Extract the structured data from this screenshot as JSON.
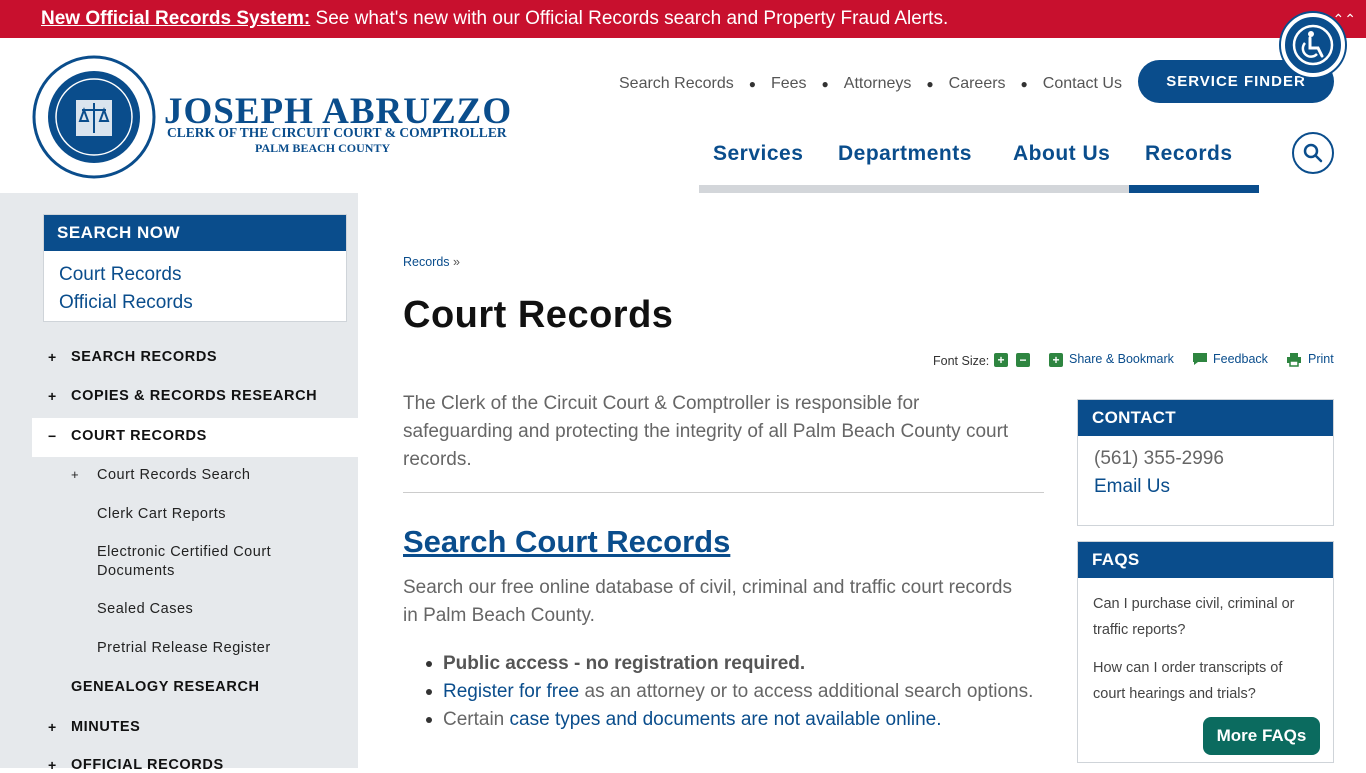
{
  "alert": {
    "link": "New Official Records System:",
    "text": " See what's new with our Official Records search and Property Fraud Alerts."
  },
  "logo": {
    "name": "JOSEPH ABRUZZO",
    "subtitle": "CLERK OF THE CIRCUIT COURT & COMPTROLLER",
    "county": "PALM BEACH COUNTY",
    "seal_text_top": "CLERK OF THE CIRCUIT COURT & COMPTROLLER",
    "seal_text_bottom": "PALM BEACH COUNTY"
  },
  "util_nav": [
    "Search Records",
    "Fees",
    "Attorneys",
    "Careers",
    "Contact Us"
  ],
  "service_finder": "SERVICE FINDER",
  "main_nav": [
    "Services",
    "Departments",
    "About Us",
    "Records"
  ],
  "search_now": {
    "title": "SEARCH NOW",
    "links": [
      "Court Records",
      "Official Records"
    ]
  },
  "sidebar": {
    "items": [
      {
        "label": "SEARCH RECORDS",
        "toggle": "+"
      },
      {
        "label": "COPIES & RECORDS RESEARCH",
        "toggle": "+"
      },
      {
        "label": "COURT RECORDS",
        "toggle": "−"
      },
      {
        "label": "GENEALOGY RESEARCH",
        "toggle": ""
      },
      {
        "label": "MINUTES",
        "toggle": "+"
      },
      {
        "label": "OFFICIAL RECORDS",
        "toggle": "+"
      }
    ],
    "sub_items": [
      {
        "label": "Court Records Search",
        "toggle": "+"
      },
      {
        "label": "Clerk Cart Reports"
      },
      {
        "label": "Electronic Certified Court Documents"
      },
      {
        "label": "Sealed Cases"
      },
      {
        "label": "Pretrial Release Register"
      }
    ]
  },
  "breadcrumb": {
    "link": "Records",
    "sep": " »"
  },
  "page_title": "Court Records",
  "tools": {
    "font_size": "Font Size:",
    "share": "Share & Bookmark",
    "feedback": "Feedback",
    "print": "Print"
  },
  "intro": "The Clerk of the Circuit Court & Comptroller is responsible for safeguarding and protecting the integrity of all Palm Beach County court records.",
  "section": {
    "title": "Search Court Records",
    "desc": "Search our free online database of civil, criminal and traffic court records in Palm Beach County.",
    "bullet1": "Public access - no registration required.",
    "bullet2_link": "Register for free",
    "bullet2_text": " as an attorney or to access additional search options.",
    "bullet3_text": "Certain ",
    "bullet3_link": "case types and documents are not available online."
  },
  "contact": {
    "title": "CONTACT",
    "phone": "(561) 355-2996",
    "email": "Email Us"
  },
  "faqs": {
    "title": "FAQS",
    "questions": [
      "Can I purchase civil, criminal or traffic reports?",
      "How can I order transcripts of court hearings and trials?"
    ],
    "more": "More FAQs"
  },
  "colors": {
    "brand_blue": "#0a4d8c",
    "alert_red": "#c8102e",
    "faq_button": "#0b6b5f",
    "tool_green": "#2e8540"
  }
}
